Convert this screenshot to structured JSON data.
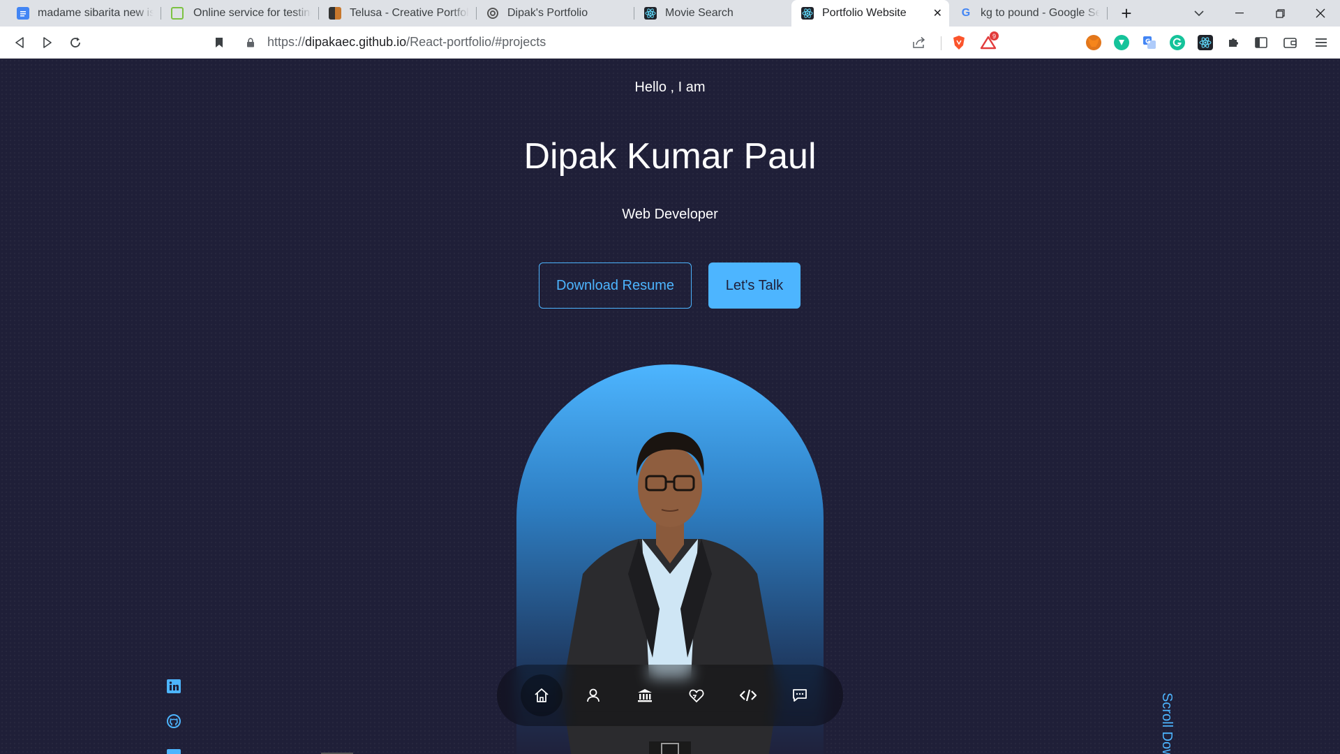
{
  "browser": {
    "tabs": [
      {
        "title": "madame sibarita new issue",
        "icon": "google-docs-icon",
        "active": false
      },
      {
        "title": "Online service for testing re",
        "icon": "testing-service-icon",
        "active": false
      },
      {
        "title": "Telusa - Creative Portfolio H",
        "icon": "telusa-icon",
        "active": false
      },
      {
        "title": "Dipak's Portfolio",
        "icon": "portfolio-logo-icon",
        "active": false
      },
      {
        "title": "Movie Search",
        "icon": "react-icon",
        "active": false
      },
      {
        "title": "Portfolio Website",
        "icon": "react-icon",
        "active": true
      },
      {
        "title": "kg to pound - Google Sear",
        "icon": "google-icon",
        "active": false
      }
    ],
    "url_prefix": "https://",
    "url_host": "dipakaec.github.io",
    "url_path": "/React-portfolio/#projects",
    "brave_rewards_badge": "9",
    "new_tab_symbol": "+",
    "accent": "#4db5ff"
  },
  "hero": {
    "greeting": "Hello , I am",
    "name": "Dipak Kumar Paul",
    "role": "Web Developer",
    "download_label": "Download Resume",
    "talk_label": "Let's Talk",
    "scroll_label": "Scroll Down",
    "background": "#1f1f38"
  },
  "socials": [
    "linkedin-icon",
    "github-icon",
    "twitter-icon"
  ],
  "nav": {
    "items": [
      "home-icon",
      "user-icon",
      "bank-icon",
      "services-icon",
      "code-icon",
      "message-icon"
    ],
    "active": "home-icon"
  }
}
